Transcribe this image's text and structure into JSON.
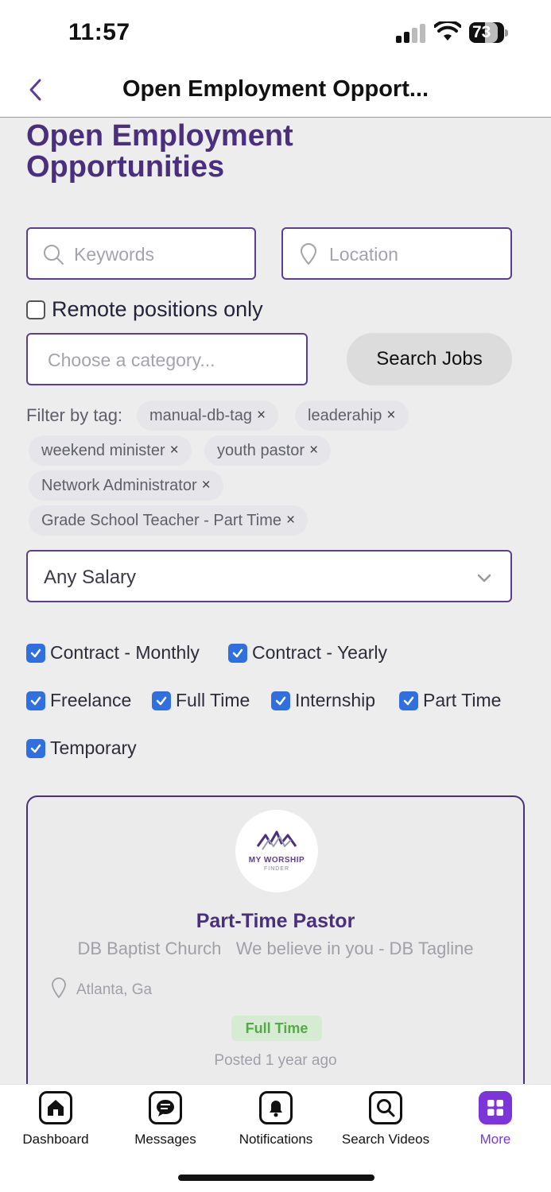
{
  "status": {
    "time": "11:57",
    "battery": "73"
  },
  "nav": {
    "title": "Open Employment Opport..."
  },
  "page_title": "Open Employment Opportunities",
  "search": {
    "keywords_placeholder": "Keywords",
    "location_placeholder": "Location",
    "remote_label": "Remote positions only",
    "category_placeholder": "Choose a category...",
    "search_button": "Search Jobs"
  },
  "filter": {
    "label": "Filter by tag:",
    "tags": [
      "manual-db-tag",
      "leaderahip",
      "weekend minister",
      "youth pastor",
      "Network Administrator",
      "Grade School Teacher - Part Time"
    ],
    "remove_glyph": "×"
  },
  "salary": {
    "value": "Any Salary"
  },
  "job_types": [
    "Contract - Monthly",
    "Contract - Yearly",
    "Freelance",
    "Full Time",
    "Internship",
    "Part Time",
    "Temporary"
  ],
  "card": {
    "logo_line1": "MY WORSHIP",
    "logo_line2": "FINDER",
    "title": "Part-Time Pastor",
    "company": "DB Baptist Church   We believe in you - DB Tagline",
    "location": "Atlanta, Ga",
    "type_badge": "Full Time",
    "posted": "Posted 1 year ago"
  },
  "tabs": [
    {
      "label": "Dashboard",
      "icon": "home-icon"
    },
    {
      "label": "Messages",
      "icon": "chat-icon"
    },
    {
      "label": "Notifications",
      "icon": "bell-icon"
    },
    {
      "label": "Search Videos",
      "icon": "search-icon"
    },
    {
      "label": "More",
      "icon": "grid-icon"
    }
  ],
  "colors": {
    "accent": "#4a2f7c",
    "active_tab": "#7b35d8",
    "checkbox": "#2f6fe0",
    "badge_text": "#56a84a"
  }
}
